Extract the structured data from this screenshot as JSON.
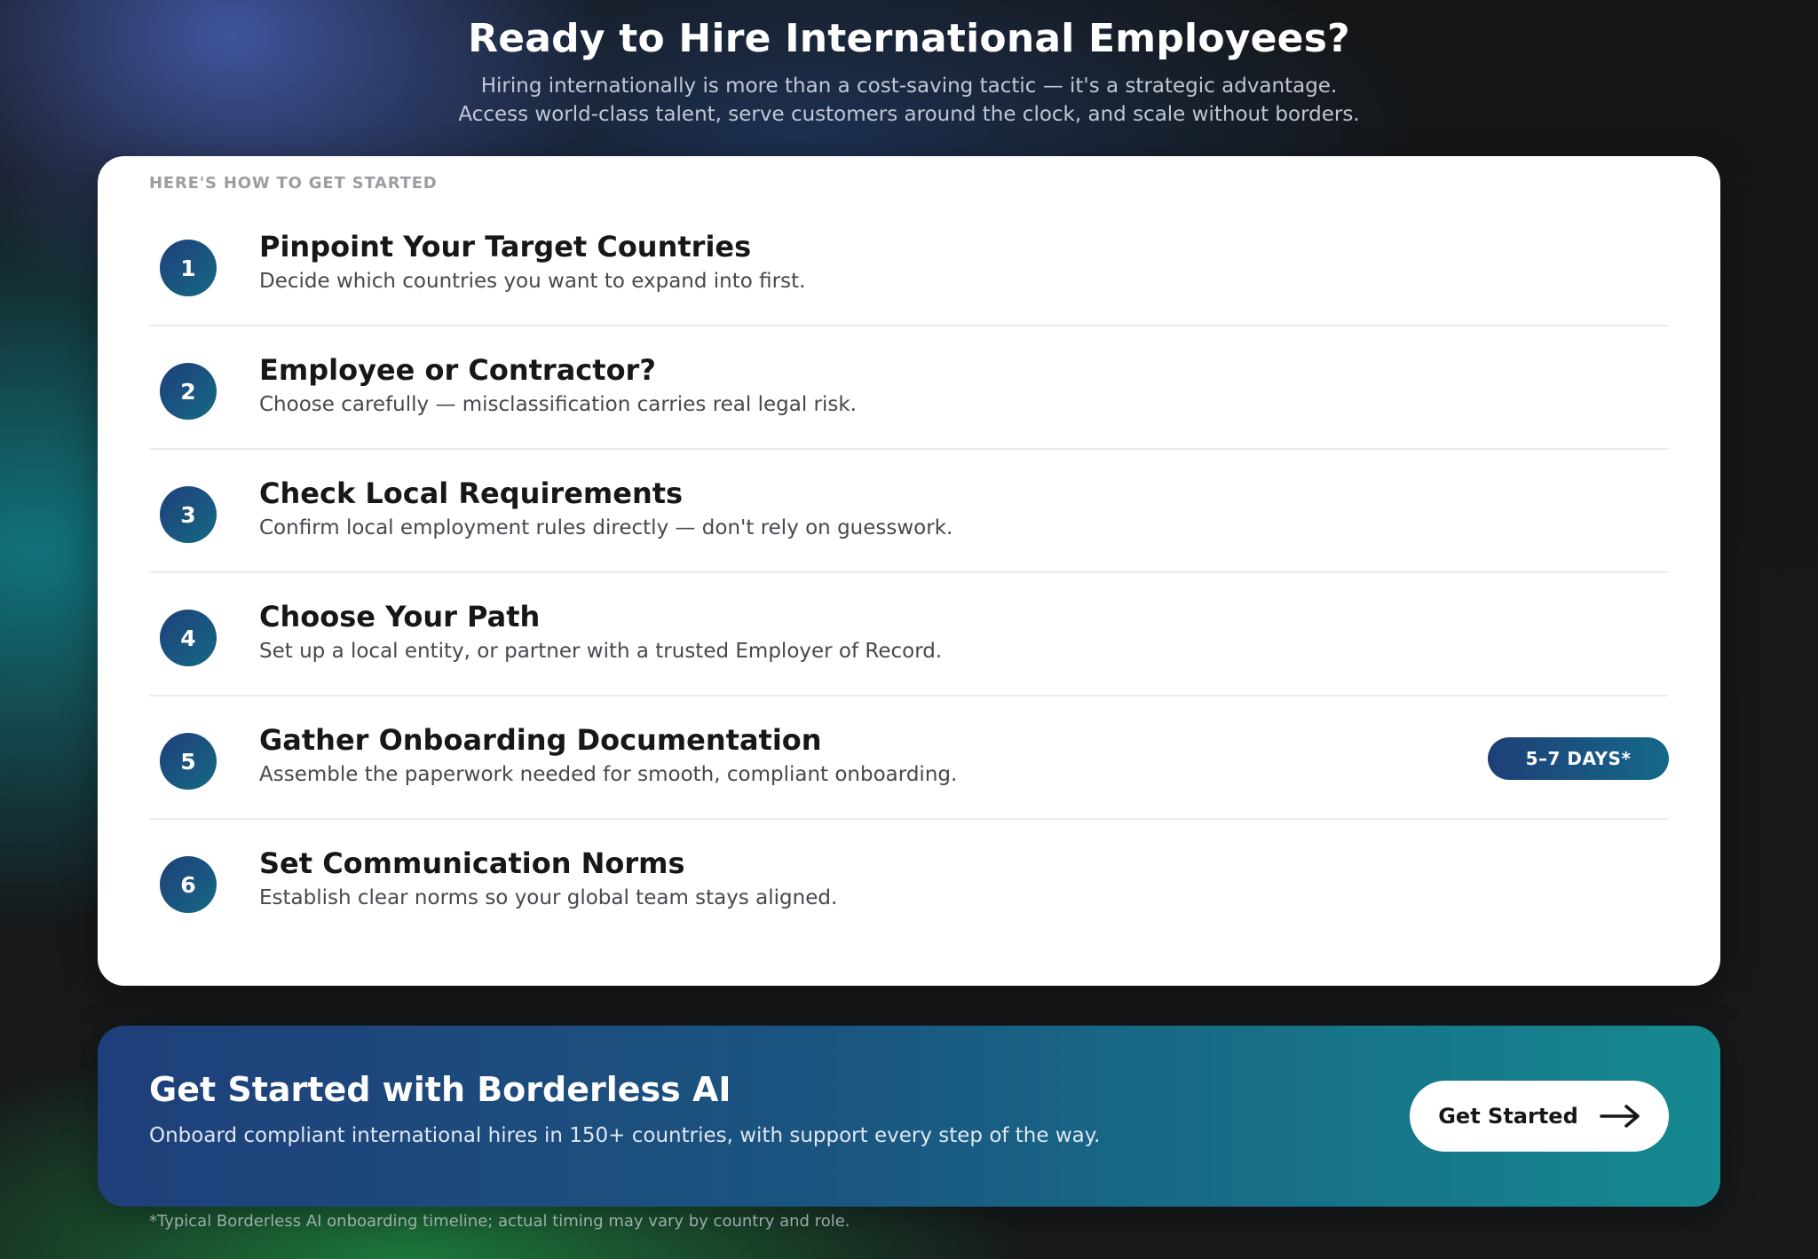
{
  "hero": {
    "title": "Ready to Hire International Employees?",
    "subtitle_line1": "Hiring internationally is more than a cost-saving tactic — it's a strategic advantage.",
    "subtitle_line2": "Access world-class talent, serve customers around the clock, and scale without borders."
  },
  "card": {
    "eyebrow": "HERE'S HOW TO GET STARTED",
    "steps": [
      {
        "number": "1",
        "title": "Pinpoint Your Target Countries",
        "desc": "Decide which countries you want to expand into first."
      },
      {
        "number": "2",
        "title": "Employee or Contractor?",
        "desc": "Choose carefully — misclassification carries real legal risk."
      },
      {
        "number": "3",
        "title": "Check Local Requirements",
        "desc": "Confirm local employment rules directly — don't rely on guesswork."
      },
      {
        "number": "4",
        "title": "Choose Your Path",
        "desc": "Set up a local entity, or partner with a trusted Employer of Record."
      },
      {
        "number": "5",
        "title": "Gather Onboarding Documentation",
        "desc": "Assemble the paperwork needed for smooth, compliant onboarding.",
        "badge": "5–7 DAYS*"
      },
      {
        "number": "6",
        "title": "Set Communication Norms",
        "desc": "Establish clear norms so your global team stays aligned."
      }
    ]
  },
  "cta": {
    "title": "Get Started with Borderless AI",
    "subtitle": "Onboard compliant international hires in 150+ countries, with support every step of the way.",
    "button_label": "Get Started",
    "button_icon": "arrow-right-icon"
  },
  "footnote": "*Typical Borderless AI onboarding timeline; actual timing may vary by country and role."
}
